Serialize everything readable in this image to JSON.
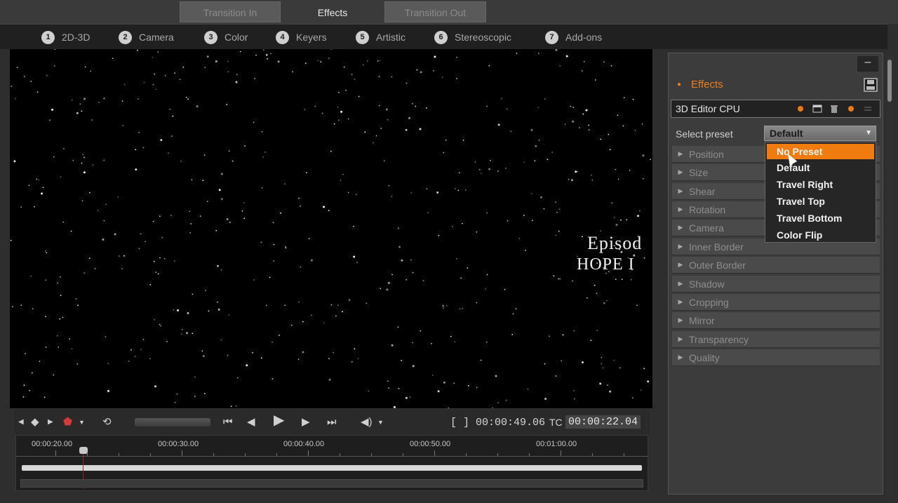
{
  "top_tabs": [
    {
      "label": "Transition In",
      "active": false
    },
    {
      "label": "Effects",
      "active": true
    },
    {
      "label": "Transition Out",
      "active": false
    }
  ],
  "subnav": [
    {
      "num": "1",
      "label": "2D-3D"
    },
    {
      "num": "2",
      "label": "Camera"
    },
    {
      "num": "3",
      "label": "Color"
    },
    {
      "num": "4",
      "label": "Keyers"
    },
    {
      "num": "5",
      "label": "Artistic"
    },
    {
      "num": "6",
      "label": "Stereoscopic"
    },
    {
      "num": "7",
      "label": "Add-ons"
    }
  ],
  "preview": {
    "line1": "Episod",
    "line2": "HOPE I",
    "line3": ". ."
  },
  "controls": {
    "timecode_total": "[ ] 00:00:49.06",
    "tc_label": "TC",
    "tc_current": "00:00:22.04"
  },
  "timeline": {
    "ruler": [
      "00:00:20.00",
      "00:00:30.00",
      "00:00:40.00",
      "00:00:50.00",
      "00:01:00.00"
    ]
  },
  "panel": {
    "minimize": "–",
    "heading": "Effects",
    "effect_name": "3D Editor CPU",
    "preset_label": "Select preset",
    "preset_value": "Default",
    "sections": [
      "Position",
      "Size",
      "Shear",
      "Rotation",
      "Camera",
      "Inner Border",
      "Outer Border",
      "Shadow",
      "Cropping",
      "Mirror",
      "Transparency",
      "Quality"
    ]
  },
  "dropdown": {
    "options": [
      "No Preset",
      "Default",
      "Travel Right",
      "Travel Top",
      "Travel Bottom",
      "Color Flip"
    ],
    "highlighted": "No Preset"
  },
  "colors": {
    "accent": "#f07c10",
    "panel_bg": "#3c3c3c",
    "preview_bg": "#000000"
  }
}
